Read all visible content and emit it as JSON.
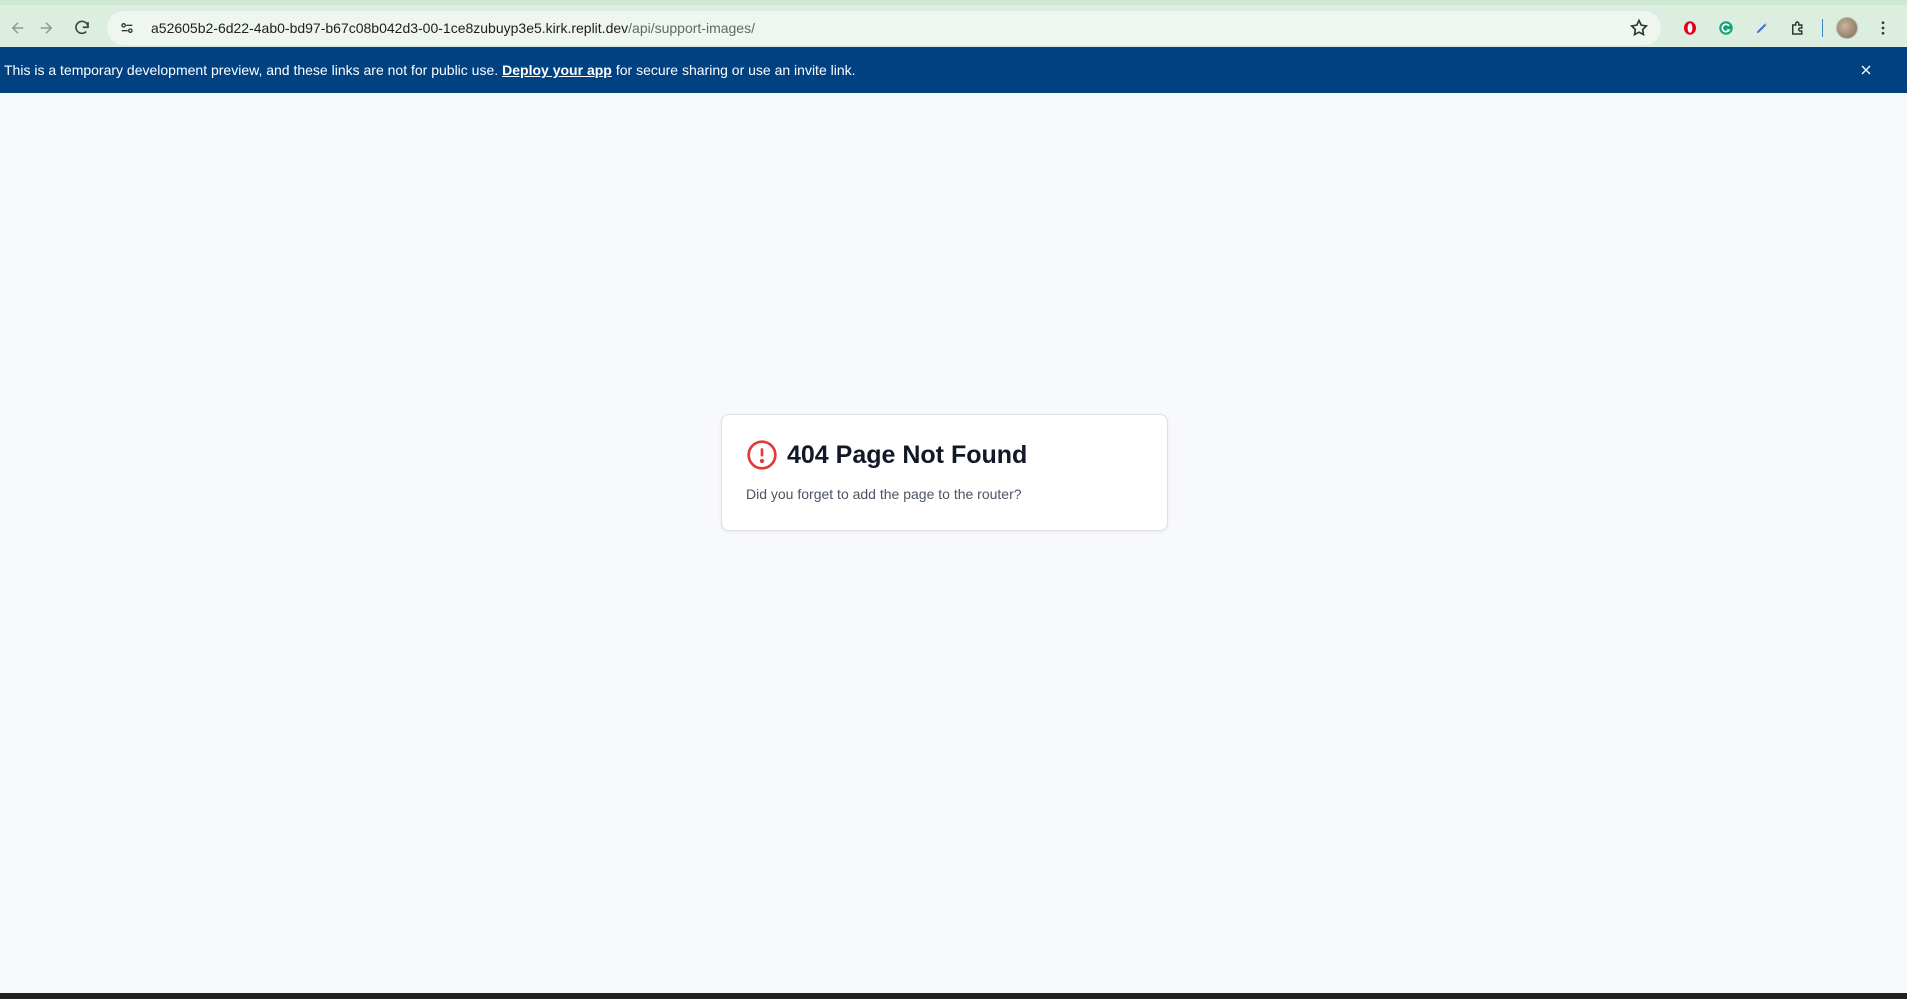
{
  "browser": {
    "url_host": "a52605b2-6d22-4ab0-bd97-b67c08b042d3-00-1ce8zubuyp3e5.kirk.replit.dev",
    "url_path": "/api/support-images/"
  },
  "banner": {
    "text_before": "This is a temporary development preview, and these links are not for public use.",
    "link_text": "Deploy your app",
    "text_after": "for secure sharing or use an invite link.",
    "background_color": "#004182"
  },
  "card": {
    "title": "404 Page Not Found",
    "message": "Did you forget to add the page to the router?",
    "icon": "alert-circle-icon",
    "icon_color": "#e03b3b"
  }
}
